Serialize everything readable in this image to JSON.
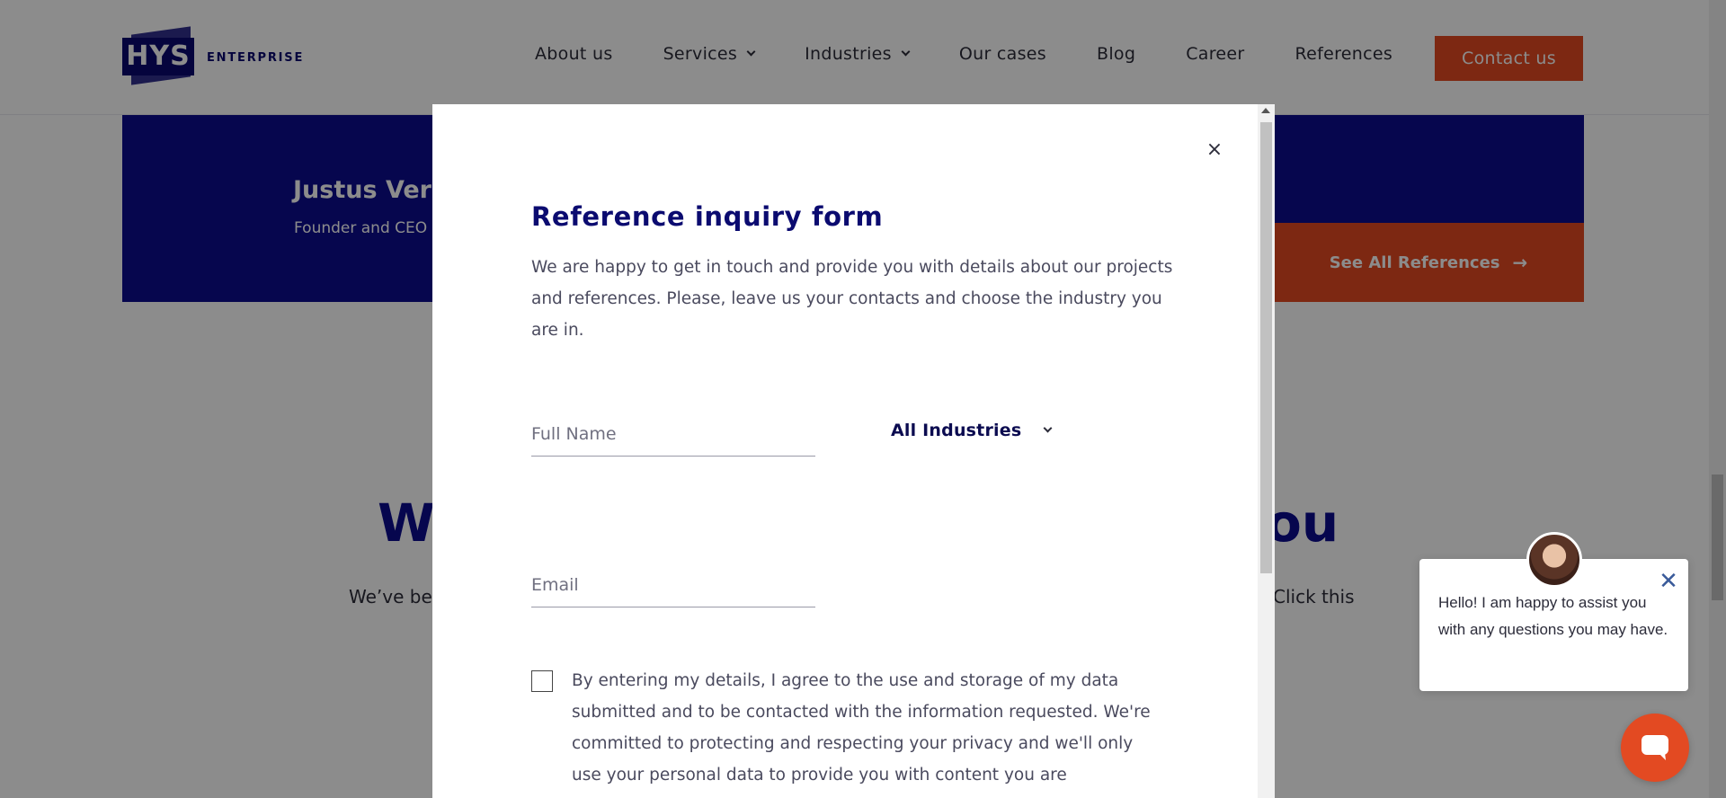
{
  "header": {
    "logo_mark": "HYS",
    "logo_text": "ENTERPRISE",
    "nav": [
      {
        "label": "About us",
        "has_dropdown": false
      },
      {
        "label": "Services",
        "has_dropdown": true
      },
      {
        "label": "Industries",
        "has_dropdown": true
      },
      {
        "label": "Our cases",
        "has_dropdown": false
      },
      {
        "label": "Blog",
        "has_dropdown": false
      },
      {
        "label": "Career",
        "has_dropdown": false
      },
      {
        "label": "References",
        "has_dropdown": false
      }
    ],
    "contact_label": "Contact us"
  },
  "testimonial": {
    "name": "Justus Verl",
    "role": "Founder and CEO",
    "see_all_label": "See All References",
    "arrow_icon": "arrow-right-icon"
  },
  "section": {
    "heading_left": "W",
    "heading_right": "ou",
    "body_left": "We’ve bee",
    "body_right": "Click this"
  },
  "modal": {
    "close_glyph": "×",
    "title": "Reference inquiry form",
    "description": "We are happy to get in touch and provide you with details about our projects and references. Please, leave us your contacts and choose the industry you are in.",
    "full_name_placeholder": "Full Name",
    "full_name_value": "",
    "industry_selected": "All Industries",
    "email_placeholder": "Email",
    "email_value": "",
    "consent_checked": false,
    "consent_text": "By entering my details, I agree to the use and storage of my data submitted and to be contacted with the information requested. We're committed to protecting and respecting your privacy and we'll only use your personal data to provide you with content you are"
  },
  "chat": {
    "message": "Hello! I am happy to assist you with any questions you may have.",
    "close_glyph": "✕",
    "launcher_icon": "chat-bubble-icon"
  },
  "colors": {
    "brand_navy": "#0b0b8e",
    "accent_orange": "#e34a22"
  }
}
